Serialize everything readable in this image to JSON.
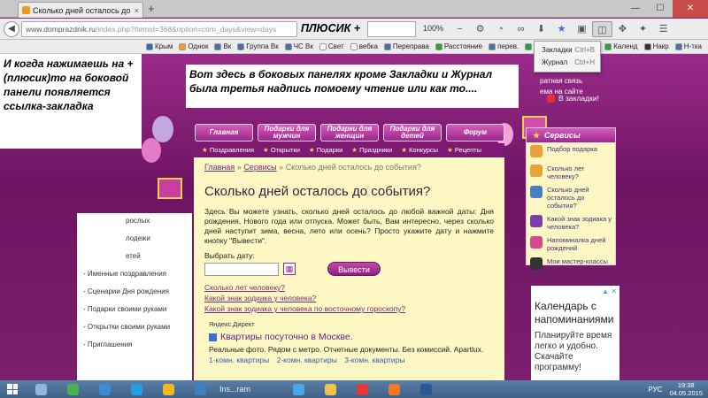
{
  "browser": {
    "tab_title": "Сколько дней осталось до со...",
    "tab_close": "×",
    "new_tab": "+",
    "url_main": "www.domprazdnik.ru",
    "url_rest": "/index.php?Itemid=368&option=com_days&view=days",
    "zoom": "100%",
    "plus_label": "ПЛЮСИК +",
    "bookmarks": [
      {
        "label": "Крым",
        "color": "#2d6fb2"
      },
      {
        "label": "Однок",
        "color": "#f39a20"
      },
      {
        "label": "Вк",
        "color": "#4a6fa5"
      },
      {
        "label": "Группа Вк",
        "color": "#4a6fa5"
      },
      {
        "label": "ЧС Вк",
        "color": "#4a6fa5"
      },
      {
        "label": "Свет",
        "color": "#ffffff"
      },
      {
        "label": "вебка",
        "color": "#ffffff"
      },
      {
        "label": "Переправа",
        "color": "#4a6fa5"
      },
      {
        "label": "Расстояние",
        "color": "#2d9e3d"
      },
      {
        "label": "перев.",
        "color": "#4a6fa5"
      },
      {
        "label": "Цен",
        "color": "#2d9e3d"
      }
    ],
    "bookmarks_right": [
      {
        "label": "Календ",
        "color": "#2d9e3d"
      },
      {
        "label": "Накр",
        "color": "#333333"
      },
      {
        "label": "Н-тка",
        "color": "#4a6fa5"
      }
    ],
    "dropdown": [
      {
        "label": "Закладки",
        "shortcut": "Ctrl+B"
      },
      {
        "label": "Журнал",
        "shortcut": "Ctrl+H"
      }
    ]
  },
  "annotations": {
    "left": "И когда нажимаешь на + (плюсик)то на боковой панели появляется ссылка-закладка",
    "center": "Вот здесь в боковых панелях кроме Закладки и Журнал была третья надпись помоему чтение или как то...."
  },
  "site": {
    "main_nav": [
      "Главная",
      "Подарки для мужчин",
      "Подарки для женщин",
      "Подарки для детей",
      "Форум"
    ],
    "sub_nav": [
      "Поздравления",
      "Открытки",
      "Подарки",
      "Праздники",
      "Конкурсы",
      "Рецепты"
    ],
    "breadcrumbs": [
      "Главная",
      "»",
      "Сервисы",
      "»",
      "Сколько дней осталось до события?"
    ],
    "title": "Сколько дней осталось до события?",
    "description": "Здесь Вы можете узнать, сколько дней осталось до любой важной даты: Дня рождения, Нового года или отпуска. Может быть, Вам интересно, через сколько дней наступит зима, весна, лето или осень? Просто укажите дату и нажмите кнопку \"Вывести\".",
    "date_label": "Выбрать дату:",
    "submit_label": "Вывести",
    "links": [
      "Сколько лет человеку?",
      "Какой знак зодиака у человека?",
      "Какой знак зодиака у человека по восточному гороскопу?"
    ],
    "yandex_direct": "Яндекс.Директ",
    "ad_title": "Квартиры посуточно в Москве.",
    "ad_text": "Реальные фото. Рядом с метро. Отчетные документы. Без комиссий. Apartlux.",
    "ad_links": [
      "1-комн. квартиры",
      "2-комн. квартиры",
      "3-комн. квартиры"
    ],
    "left_list": [
      "- Именные поздравления",
      "- Сценарии Дня рождения",
      "- Подарки своими руками",
      "- Открытки своими руками",
      "- Приглашения"
    ],
    "left_list_partial": [
      "рослых",
      "лодежи",
      "етей"
    ],
    "right_top_links": [
      "ратная связь",
      "ема на сайте"
    ],
    "bookmark_link": "В закладки!",
    "services_header": "Сервисы",
    "services": [
      {
        "label": "Подбор подарка",
        "color": "#e8a23a"
      },
      {
        "label": "Сколько лет человеку?",
        "color": "#e8a23a"
      },
      {
        "label": "Сколько дней осталось до события?",
        "color": "#4a7fc4"
      },
      {
        "label": "Какой знак зодиака у человека?",
        "color": "#7a3fa8"
      },
      {
        "label": "Напоминалка дней рождений",
        "color": "#d44a8a"
      },
      {
        "label": "Мои мастер-классы",
        "color": "#333333"
      }
    ],
    "side_ad": {
      "close": "▲ ✕",
      "title": "Календарь с напоминаниями",
      "subtitle": "Планируйте время легко и удобно. Скачайте программу!"
    }
  },
  "taskbar": {
    "items": [
      {
        "name": "files",
        "color": "#8fb7e0"
      },
      {
        "name": "chrome",
        "color": "#4caf50"
      },
      {
        "name": "browser-b",
        "color": "#3b8bd6"
      },
      {
        "name": "skype",
        "color": "#1fa0e2"
      },
      {
        "name": "zynga",
        "color": "#f3b81c"
      },
      {
        "name": "explorer",
        "color": "#3f7fbf"
      },
      {
        "name": "ie",
        "color": "#4ba6e8"
      },
      {
        "name": "folder",
        "color": "#f0c34b"
      },
      {
        "name": "yandex",
        "color": "#e53935"
      },
      {
        "name": "firefox",
        "color": "#f47a22"
      },
      {
        "name": "word",
        "color": "#2b579a"
      }
    ],
    "wide_label": "Ins...ram",
    "lang": "РУС",
    "time": "19:38",
    "date": "04.05.2015"
  }
}
